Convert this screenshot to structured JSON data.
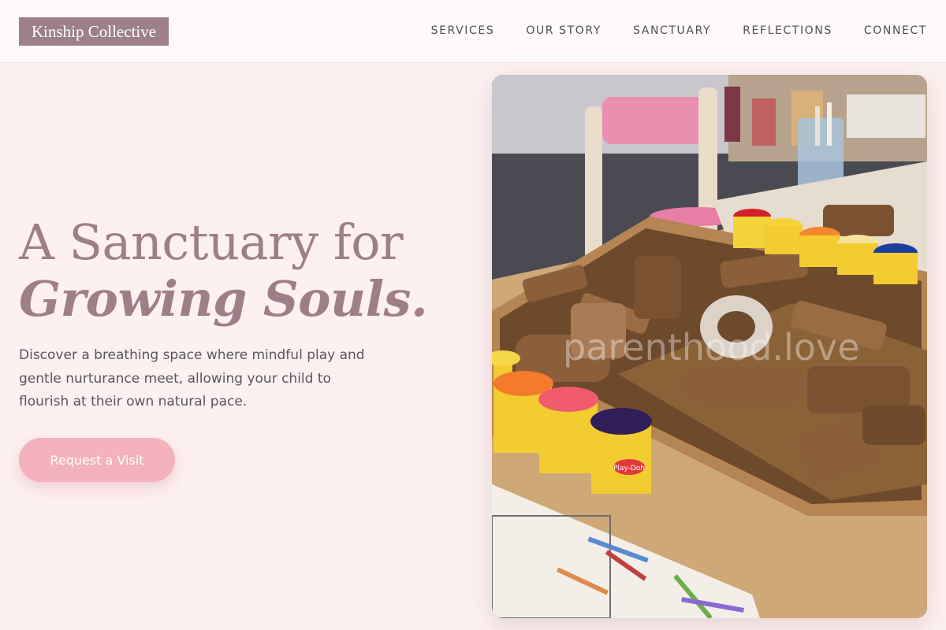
{
  "header": {
    "logo": "Kinship Collective",
    "nav": [
      {
        "label": "SERVICES"
      },
      {
        "label": "OUR STORY"
      },
      {
        "label": "SANCTUARY"
      },
      {
        "label": "REFLECTIONS"
      },
      {
        "label": "CONNECT"
      }
    ]
  },
  "hero": {
    "title_line1": "A Sanctuary for",
    "title_line2": "Growing Souls.",
    "description": "Discover a breathing space where mindful play and gentle nurturance meet, allowing your child to flourish at their own natural pace.",
    "cta_label": "Request a Visit"
  },
  "image": {
    "watermark": "parenthood.love",
    "playdoh_label": "Play-Doh"
  },
  "colors": {
    "page_bg": "#fdf0f0",
    "accent": "#9e7f88",
    "button": "#f3b2bc",
    "text": "#585663"
  }
}
